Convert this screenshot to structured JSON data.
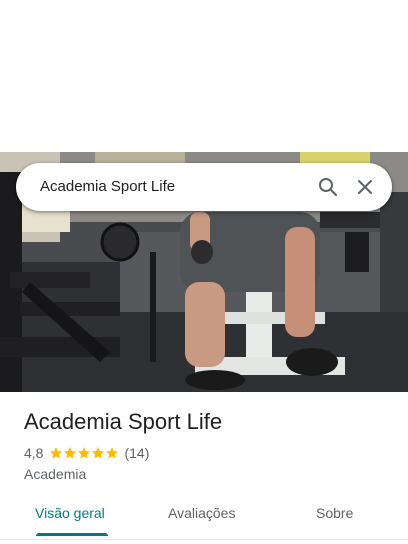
{
  "search": {
    "query": "Academia Sport Life"
  },
  "photo": {
    "alt_subject": "gym-interior-photo"
  },
  "place": {
    "name": "Academia Sport Life",
    "rating": "4,8",
    "rating_value": 4.8,
    "stars_filled": 5,
    "review_count": "(14)",
    "category": "Academia"
  },
  "tabs": [
    {
      "label": "Visão geral",
      "active": true
    },
    {
      "label": "Avaliações",
      "active": false
    },
    {
      "label": "Sobre",
      "active": false
    }
  ],
  "colors": {
    "accent": "#007b83",
    "star": "#fbbc04",
    "secondary_text": "#5f6368",
    "primary_text": "#202124"
  }
}
